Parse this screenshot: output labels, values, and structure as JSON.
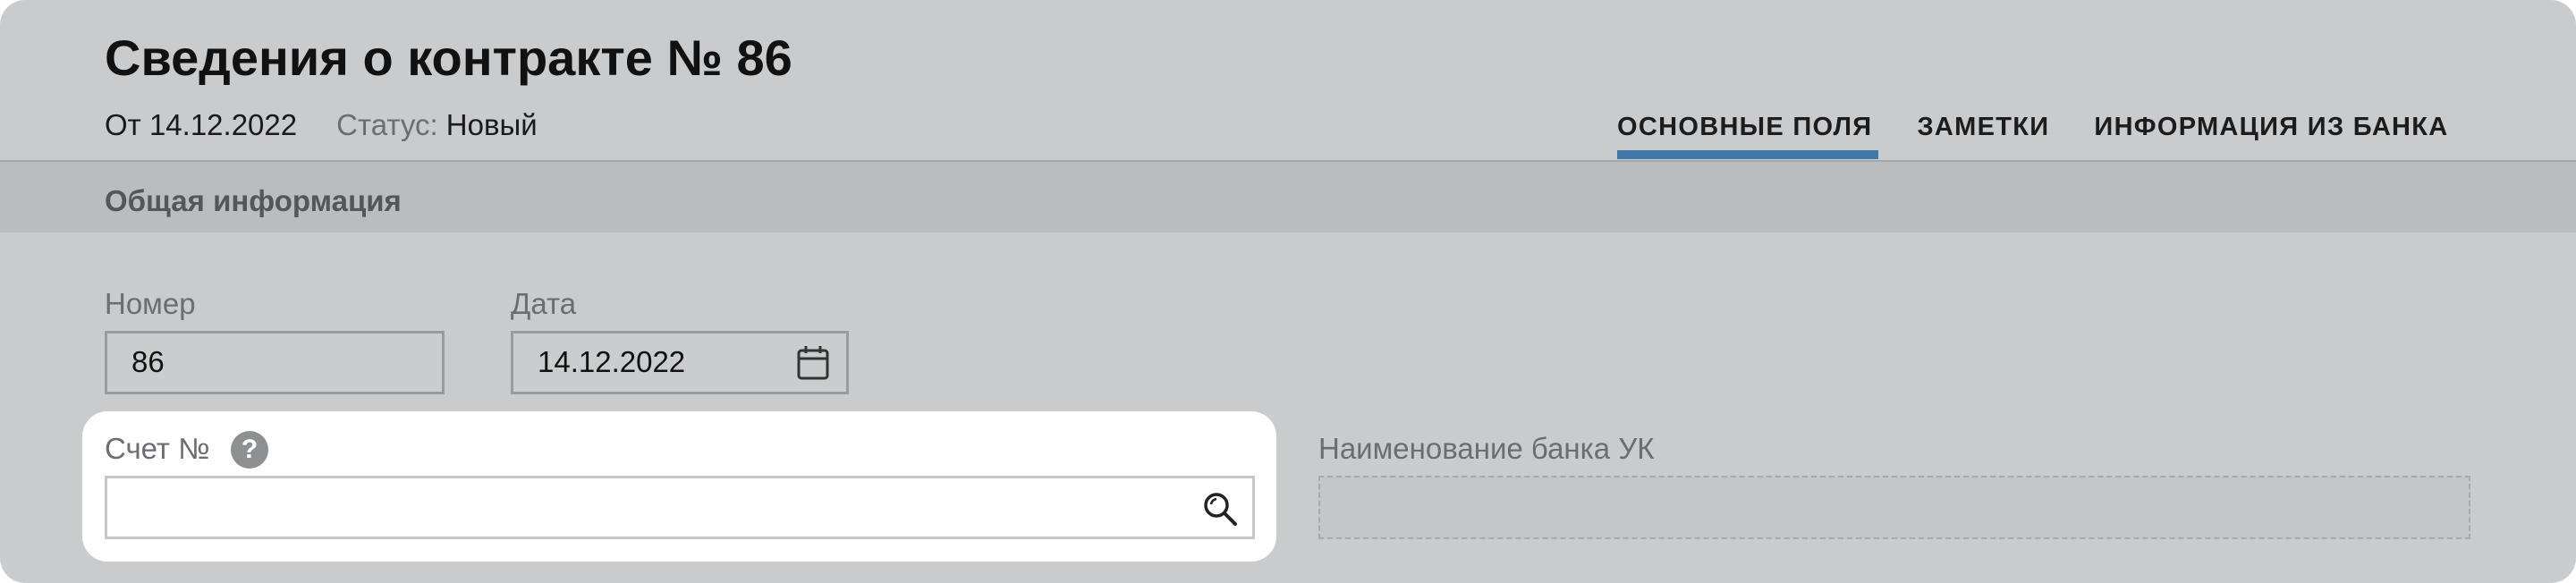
{
  "header": {
    "title": "Сведения о контракте № 86",
    "date_text": "От 14.12.2022",
    "status_label": "Статус:",
    "status_value": "Новый"
  },
  "tabs": [
    {
      "label": "ОСНОВНЫЕ ПОЛЯ",
      "active": true
    },
    {
      "label": "ЗАМЕТКИ",
      "active": false
    },
    {
      "label": "ИНФОРМАЦИЯ ИЗ БАНКА",
      "active": false
    }
  ],
  "section": {
    "title": "Общая информация"
  },
  "fields": {
    "number": {
      "label": "Номер",
      "value": "86"
    },
    "date": {
      "label": "Дата",
      "value": "14.12.2022",
      "icon": "calendar-icon"
    },
    "account": {
      "label": "Счет №",
      "value": "",
      "help_icon": "?",
      "icon": "search-icon"
    },
    "bank_name": {
      "label": "Наименование банка УК",
      "value": ""
    }
  },
  "colors": {
    "accent": "#3f78a9",
    "background": "#cacbcd",
    "section_bar": "#bbbcbe",
    "highlight": "#ffffff"
  }
}
